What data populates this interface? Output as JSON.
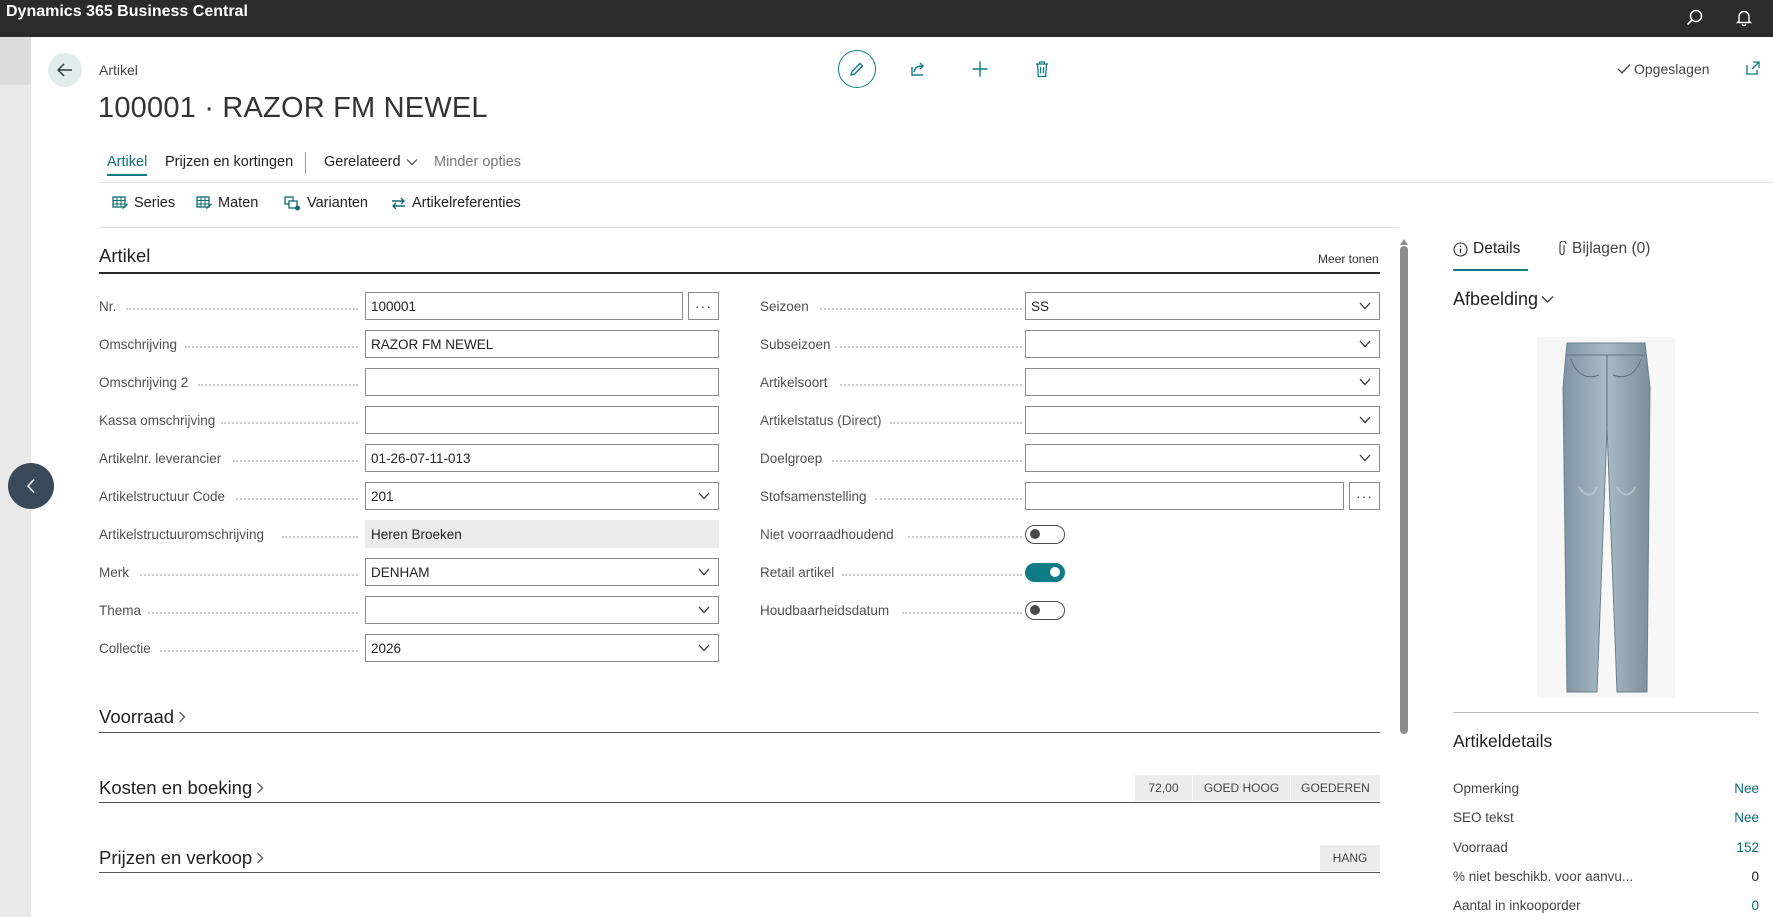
{
  "app": {
    "title": "Dynamics 365 Business Central"
  },
  "header": {
    "breadcrumb": "Artikel",
    "record_title": "100001 · RAZOR FM NEWEL",
    "saved_status": "Opgeslagen"
  },
  "tabs": [
    {
      "label": "Artikel"
    },
    {
      "label": "Prijzen en kortingen"
    },
    {
      "label": "Gerelateerd"
    },
    {
      "label": "Minder opties"
    }
  ],
  "actions": [
    {
      "label": "Series",
      "icon": "grid-edit-icon"
    },
    {
      "label": "Maten",
      "icon": "grid-edit-icon"
    },
    {
      "label": "Varianten",
      "icon": "variants-icon"
    },
    {
      "label": "Artikelreferenties",
      "icon": "swap-arrows-icon"
    }
  ],
  "section_artikel": {
    "title": "Artikel",
    "show_more": "Meer tonen",
    "left_fields": [
      {
        "label": "Nr.",
        "value": "100001"
      },
      {
        "label": "Omschrijving",
        "value": "RAZOR FM NEWEL"
      },
      {
        "label": "Omschrijving 2",
        "value": ""
      },
      {
        "label": "Kassa omschrijving",
        "value": ""
      },
      {
        "label": "Artikelnr. leverancier",
        "value": "01-26-07-11-013"
      },
      {
        "label": "Artikelstructuur Code",
        "value": "201"
      },
      {
        "label": "Artikelstructuuromschrijving",
        "value": "Heren Broeken"
      },
      {
        "label": "Merk",
        "value": "DENHAM"
      },
      {
        "label": "Thema",
        "value": ""
      },
      {
        "label": "Collectie",
        "value": "2026"
      }
    ],
    "right_fields": [
      {
        "label": "Seizoen",
        "value": "SS"
      },
      {
        "label": "Subseizoen",
        "value": ""
      },
      {
        "label": "Artikelsoort",
        "value": ""
      },
      {
        "label": "Artikelstatus (Direct)",
        "value": ""
      },
      {
        "label": "Doelgroep",
        "value": ""
      },
      {
        "label": "Stofsamenstelling",
        "value": ""
      },
      {
        "label": "Niet voorraadhoudend",
        "value": false
      },
      {
        "label": "Retail artikel",
        "value": true
      },
      {
        "label": "Houdbaarheidsdatum",
        "value": false
      }
    ]
  },
  "section_voorraad": {
    "title": "Voorraad"
  },
  "section_kosten": {
    "title": "Kosten en boeking",
    "pills": [
      "72,00",
      "GOED HOOG",
      "GOEDEREN"
    ]
  },
  "section_prijzen": {
    "title": "Prijzen en verkoop",
    "pills": [
      "HANG"
    ]
  },
  "factbox": {
    "tab_details": "Details",
    "tab_attachments": "Bijlagen (0)",
    "picture_title": "Afbeelding",
    "details_title": "Artikeldetails",
    "rows": [
      {
        "label": "Opmerking",
        "value": "Nee",
        "link": true
      },
      {
        "label": "SEO tekst",
        "value": "Nee",
        "link": true
      },
      {
        "label": "Voorraad",
        "value": "152",
        "link": true
      },
      {
        "label": "% niet beschikb. voor aanvu...",
        "value": "0",
        "link": false
      },
      {
        "label": "Aantal in inkooporder",
        "value": "0",
        "link": true
      }
    ]
  },
  "colors": {
    "accent": "#0f7b86",
    "topbar": "#2b2b2b",
    "link": "#0c6e74"
  }
}
